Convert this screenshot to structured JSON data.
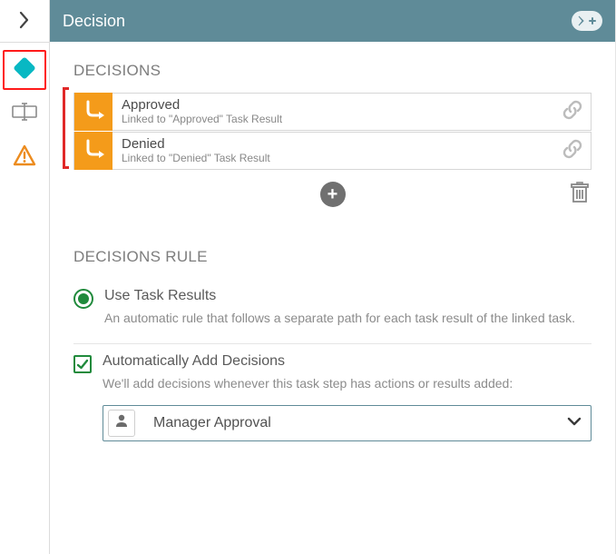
{
  "header": {
    "title": "Decision"
  },
  "sections": {
    "decisions": {
      "title": "DECISIONS",
      "items": [
        {
          "name": "Approved",
          "sub": "Linked to \"Approved\" Task Result"
        },
        {
          "name": "Denied",
          "sub": "Linked to \"Denied\" Task Result"
        }
      ]
    },
    "rule": {
      "title": "DECISIONS RULE",
      "option_task_results": {
        "title": "Use Task Results",
        "desc": "An automatic rule that follows a separate path for each task result of the linked task.",
        "selected": true
      },
      "option_auto_add": {
        "title": "Automatically Add Decisions",
        "desc": "We'll add decisions whenever this task step has actions or results added:",
        "checked": true,
        "selected_task": "Manager Approval"
      }
    }
  },
  "sidebar": {
    "active_tab": "decision-diamond",
    "items": [
      "decision-diamond",
      "textbox-tool",
      "warning"
    ]
  },
  "colors": {
    "header_bg": "#5f8b98",
    "accent_orange": "#f49b1a",
    "highlight_red": "#ff1a1a",
    "diamond_teal": "#08b8c3",
    "warning_orange": "#ec8c1f",
    "check_green": "#208a3c"
  },
  "icons": {
    "chevron_right": "chevron-right-icon",
    "diamond": "diamond-icon",
    "textbox": "textbox-icon",
    "warning": "warning-icon",
    "add_pointer": "add-pointer-icon",
    "branch_arrow": "branch-arrow-icon",
    "link": "link-icon",
    "plus": "plus-icon",
    "trash": "trash-icon",
    "user": "user-icon",
    "chevron_down": "chevron-down-icon",
    "check": "check-icon"
  }
}
